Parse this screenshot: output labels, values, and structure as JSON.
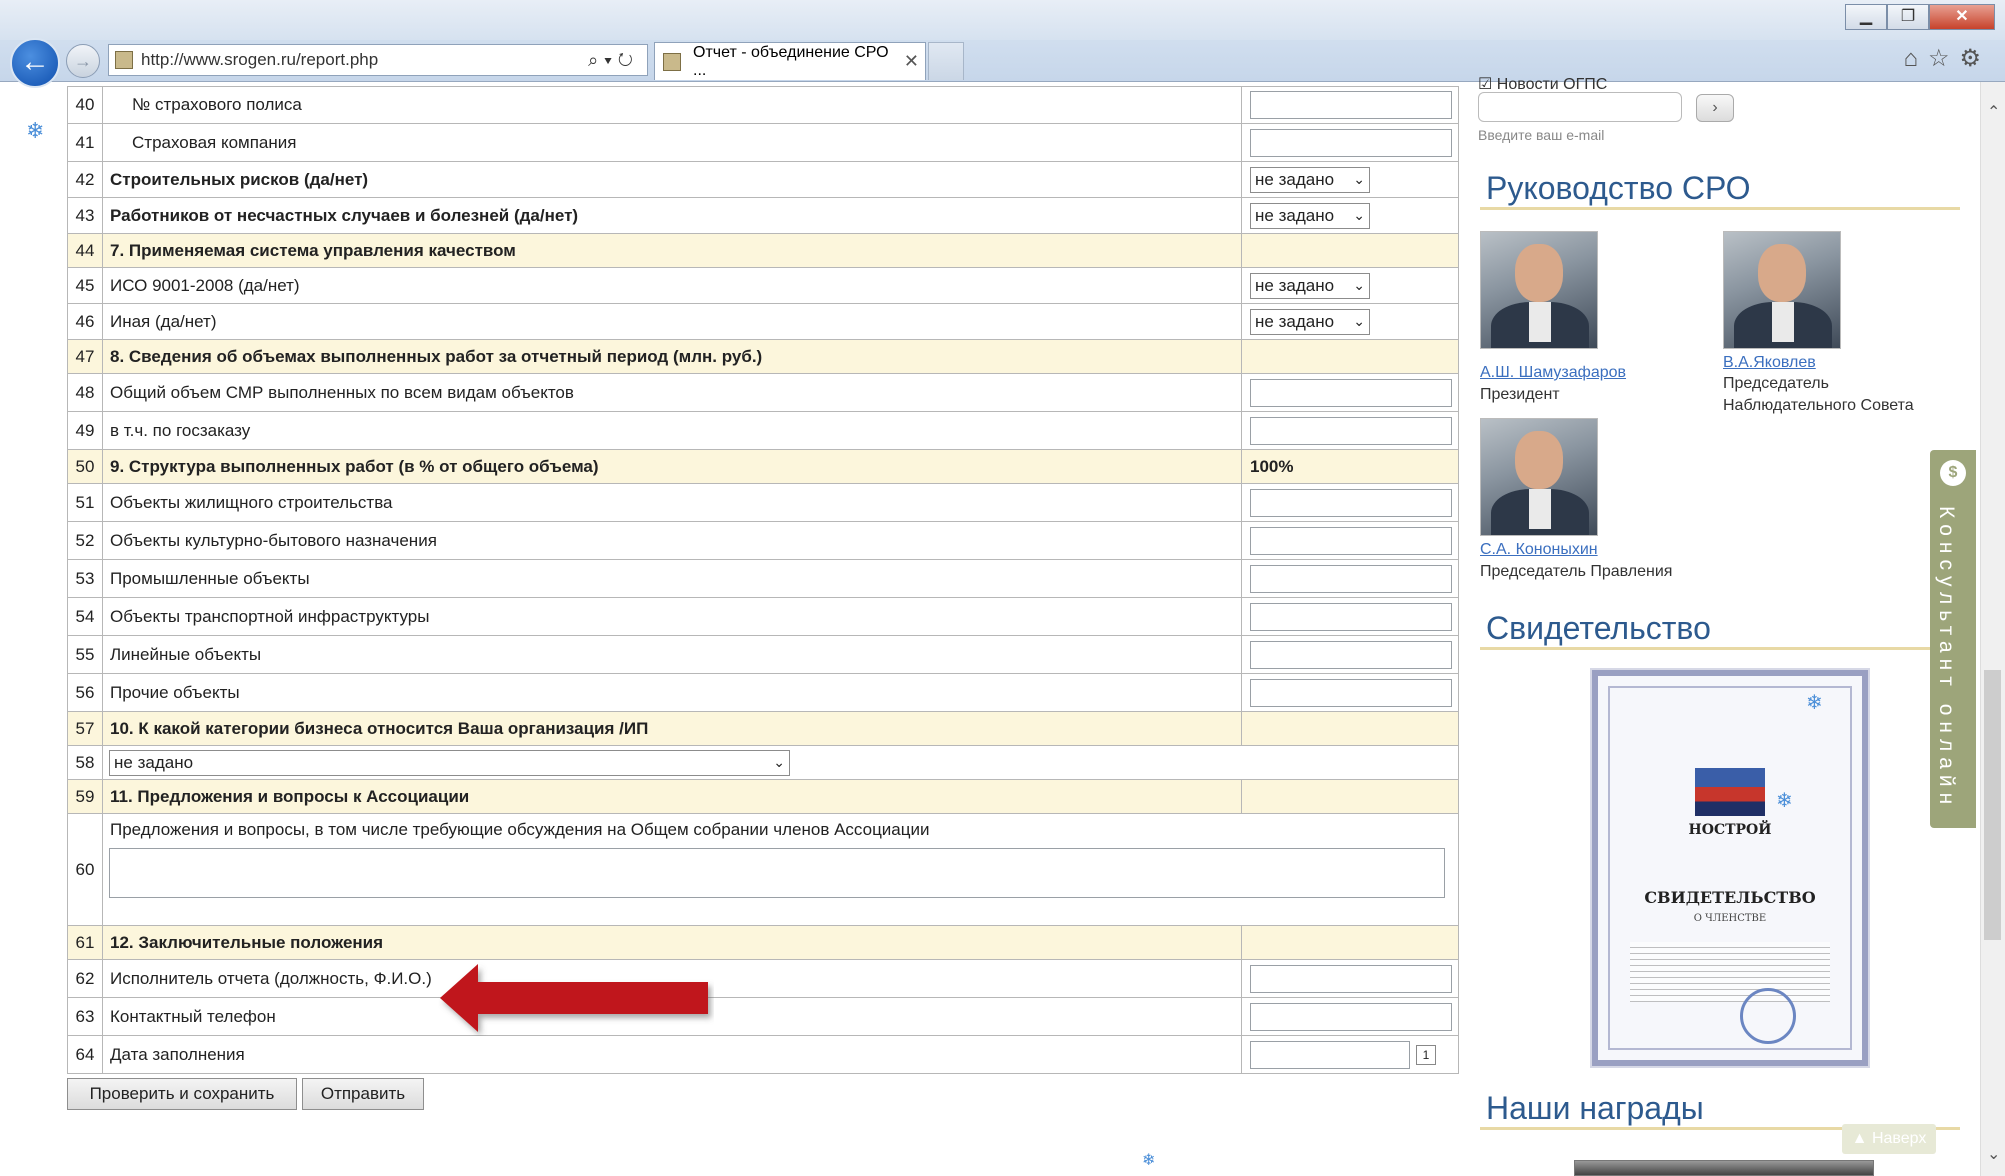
{
  "browser": {
    "url": "http://www.srogen.ru/report.php",
    "tab_title": "Отчет - объединение СРО ...",
    "minimize": "▁",
    "maximize": "❐",
    "close": "✕"
  },
  "form": {
    "rows": [
      {
        "n": "40",
        "label": "№ страхового полиса",
        "type": "input",
        "indent": true
      },
      {
        "n": "41",
        "label": "Страховая компания",
        "type": "input",
        "indent": true
      },
      {
        "n": "42",
        "label": "Строительных рисков (да/нет)",
        "type": "select",
        "bold": true,
        "value": "не задано"
      },
      {
        "n": "43",
        "label": "Работников от несчастных случаев и болезней (да/нет)",
        "type": "select",
        "bold": true,
        "value": "не задано"
      },
      {
        "n": "44",
        "label": "7. Применяемая система управления качеством",
        "type": "section"
      },
      {
        "n": "45",
        "label": "ИСО 9001-2008 (да/нет)",
        "type": "select",
        "value": "не задано"
      },
      {
        "n": "46",
        "label": "Иная (да/нет)",
        "type": "select",
        "value": "не задано"
      },
      {
        "n": "47",
        "label": "8. Сведения об объемах выполненных работ за отчетный период (млн. руб.)",
        "type": "section"
      },
      {
        "n": "48",
        "label": "Общий объем СМР выполненных по всем видам объектов",
        "type": "input"
      },
      {
        "n": "49",
        "label": "в т.ч. по госзаказу",
        "type": "input"
      },
      {
        "n": "50",
        "label": "9. Структура выполненных работ (в % от общего объема)",
        "type": "section",
        "value": "100%"
      },
      {
        "n": "51",
        "label": "Объекты жилищного строительства",
        "type": "input"
      },
      {
        "n": "52",
        "label": "Объекты культурно-бытового назначения",
        "type": "input"
      },
      {
        "n": "53",
        "label": "Промышленные объекты",
        "type": "input"
      },
      {
        "n": "54",
        "label": "Объекты транспортной инфраструктуры",
        "type": "input"
      },
      {
        "n": "55",
        "label": "Линейные объекты",
        "type": "input"
      },
      {
        "n": "56",
        "label": "Прочие объекты",
        "type": "input"
      },
      {
        "n": "57",
        "label": "10. К какой категории бизнеса относится Ваша организация /ИП",
        "type": "section"
      },
      {
        "n": "58",
        "label": "",
        "type": "bigselect",
        "value": "не задано"
      },
      {
        "n": "59",
        "label": "11. Предложения и вопросы к Ассоциации",
        "type": "section"
      },
      {
        "n": "60",
        "label": "Предложения и вопросы, в том числе требующие обсуждения на Общем собрании членов Ассоциации",
        "type": "textarea"
      },
      {
        "n": "61",
        "label": "12. Заключительные положения",
        "type": "section"
      },
      {
        "n": "62",
        "label": "Исполнитель отчета (должность, Ф.И.О.)",
        "type": "input"
      },
      {
        "n": "63",
        "label": "Контактный телефон",
        "type": "input"
      },
      {
        "n": "64",
        "label": "Дата заполнения",
        "type": "date",
        "cal": "1"
      }
    ],
    "buttons": {
      "check_save": "Проверить и сохранить",
      "send": "Отправить"
    }
  },
  "sidebar": {
    "news_option": "Новости ОГПС",
    "email_hint": "Введите ваш e-mail",
    "go": "›",
    "leadership_title": "Руководство СРО",
    "people": [
      {
        "name": "А.Ш. Шамузафаров",
        "role": "Президент"
      },
      {
        "name": "В.А.Яковлев",
        "role": "Председатель",
        "role2": "Наблюдательного Совета"
      },
      {
        "name": "С.А. Кононыхин",
        "role": "Председатель Правления"
      }
    ],
    "certificate_title": "Свидетельство",
    "certificate": {
      "org": "НОСТРОЙ",
      "heading": "СВИДЕТЕЛЬСТВО",
      "sub": "О ЧЛЕНСТВЕ"
    },
    "awards_title": "Наши награды",
    "consultant": "Консультант онлайн",
    "top": "▲ Наверх"
  },
  "colors": {
    "section_bg": "#fcf6dc",
    "link": "#3b6fbf",
    "title": "#2d5a8e",
    "arrow": "#c0151b"
  }
}
